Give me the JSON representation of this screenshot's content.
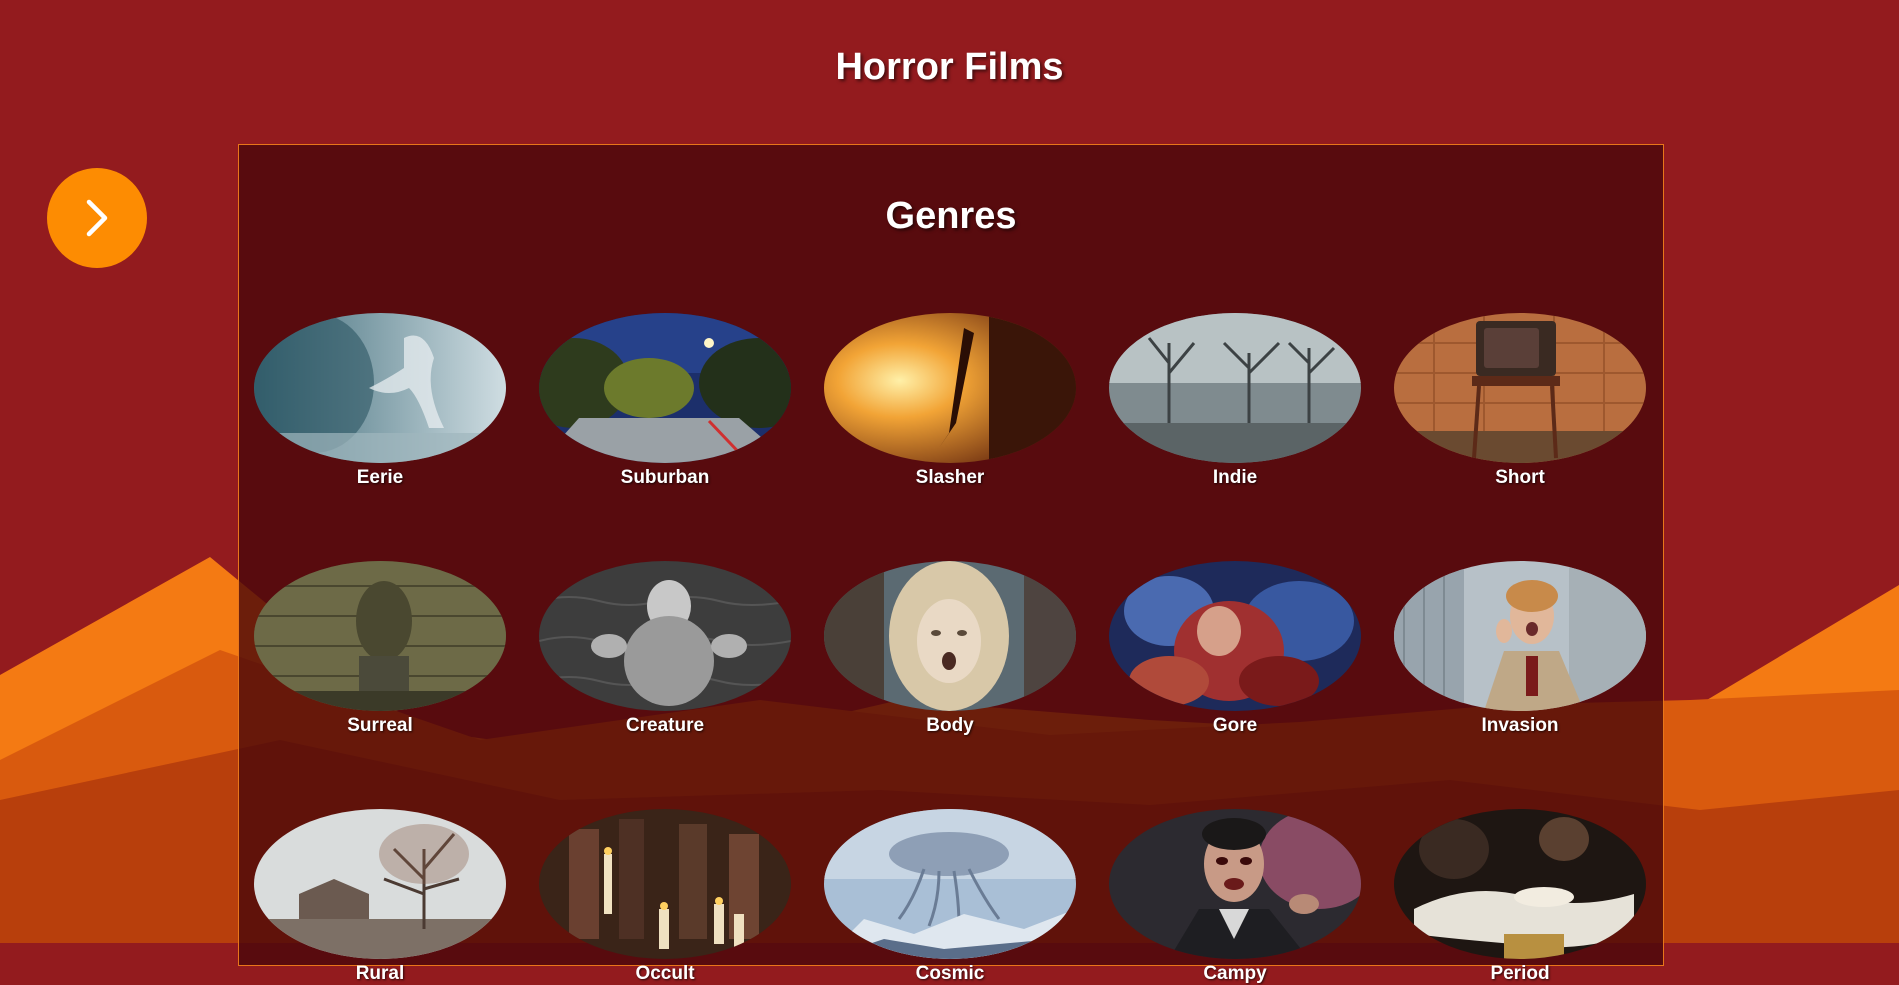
{
  "page": {
    "title": "Horror Films",
    "next_button": {
      "icon": "chevron-right-icon",
      "label": "Next"
    }
  },
  "panel": {
    "title": "Genres",
    "genres": [
      {
        "label": "Eerie"
      },
      {
        "label": "Suburban"
      },
      {
        "label": "Slasher"
      },
      {
        "label": "Indie"
      },
      {
        "label": "Short"
      },
      {
        "label": "Surreal"
      },
      {
        "label": "Creature"
      },
      {
        "label": "Body"
      },
      {
        "label": "Gore"
      },
      {
        "label": "Invasion"
      },
      {
        "label": "Rural"
      },
      {
        "label": "Occult"
      },
      {
        "label": "Cosmic"
      },
      {
        "label": "Campy"
      },
      {
        "label": "Period"
      }
    ]
  },
  "colors": {
    "background": "#931b1e",
    "panel": "#4a080a",
    "panel_border": "#e8761a",
    "accent": "#fd8c02",
    "mountain_light": "#f47a13",
    "mountain_mid": "#d95a0e",
    "mountain_dark": "#b83f0c"
  }
}
